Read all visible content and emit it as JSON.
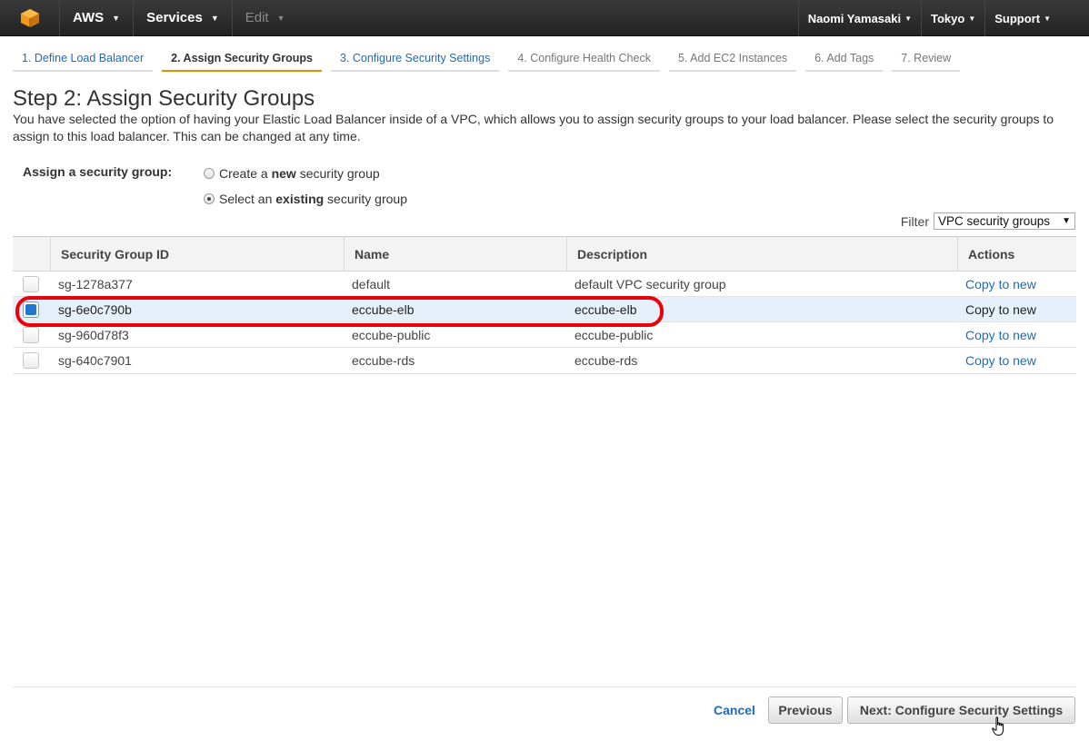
{
  "topnav": {
    "brand": "AWS",
    "services": "Services",
    "edit": "Edit",
    "user": "Naomi Yamasaki",
    "region": "Tokyo",
    "support": "Support"
  },
  "wizard_steps": [
    "1. Define Load Balancer",
    "2. Assign Security Groups",
    "3. Configure Security Settings",
    "4. Configure Health Check",
    "5. Add EC2 Instances",
    "6. Add Tags",
    "7. Review"
  ],
  "page": {
    "title": "Step 2: Assign Security Groups",
    "intro": "You have selected the option of having your Elastic Load Balancer inside of a VPC, which allows you to assign security groups to your load balancer. Please select the security groups to assign to this load balancer. This can be changed at any time."
  },
  "assign": {
    "label": "Assign a security group:",
    "option_new_prefix": "Create a ",
    "option_new_bold": "new",
    "option_new_suffix": " security group",
    "option_existing_prefix": "Select an ",
    "option_existing_bold": "existing",
    "option_existing_suffix": " security group",
    "selected": "existing"
  },
  "filter": {
    "label": "Filter",
    "value": "VPC security groups"
  },
  "table": {
    "headers": [
      "Security Group ID",
      "Name",
      "Description",
      "Actions"
    ],
    "rows": [
      {
        "id": "sg-1278a377",
        "name": "default",
        "description": "default VPC security group",
        "action": "Copy to new",
        "checked": false
      },
      {
        "id": "sg-6e0c790b",
        "name": "eccube-elb",
        "description": "eccube-elb",
        "action": "Copy to new",
        "checked": true
      },
      {
        "id": "sg-960d78f3",
        "name": "eccube-public",
        "description": "eccube-public",
        "action": "Copy to new",
        "checked": false
      },
      {
        "id": "sg-640c7901",
        "name": "eccube-rds",
        "description": "eccube-rds",
        "action": "Copy to new",
        "checked": false
      }
    ]
  },
  "footer": {
    "cancel": "Cancel",
    "previous": "Previous",
    "next": "Next: Configure Security Settings"
  },
  "colors": {
    "link": "#1e6bb8",
    "active_step_underline": "#e48f00",
    "highlight_annotation": "#e8000b",
    "logo_orange": "#f7981d"
  },
  "icons": {
    "logo": "aws-cube-icon",
    "cursor": "hand-pointer-icon"
  }
}
